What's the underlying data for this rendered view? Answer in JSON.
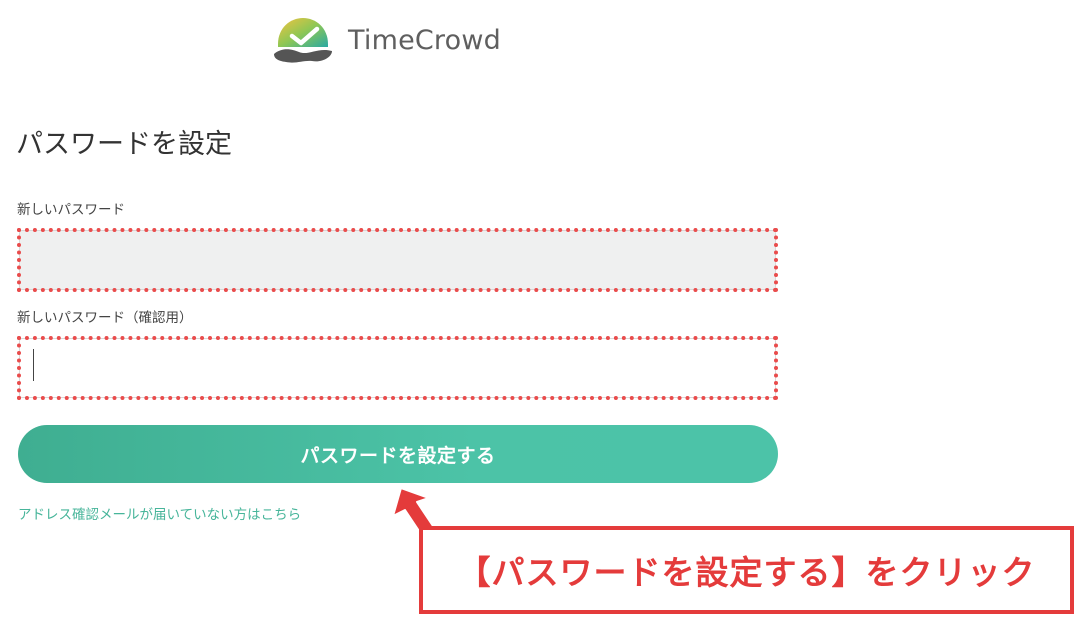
{
  "brand": {
    "name": "TimeCrowd",
    "colors": {
      "accent": "#47b59a",
      "button_start": "#3fae91",
      "button_end": "#4cc3a8",
      "highlight_red": "#e43b3b"
    }
  },
  "page": {
    "title": "パスワードを設定"
  },
  "form": {
    "new_password": {
      "label": "新しいパスワード",
      "value": ""
    },
    "confirm_password": {
      "label": "新しいパスワード（確認用）",
      "value": ""
    },
    "submit_label": "パスワードを設定する",
    "resend_link": "アドレス確認メールが届いていない方はこちら"
  },
  "annotation": {
    "callout_text": "【パスワードを設定する】をクリック",
    "arrow_icon": "arrow-up-left-icon"
  }
}
